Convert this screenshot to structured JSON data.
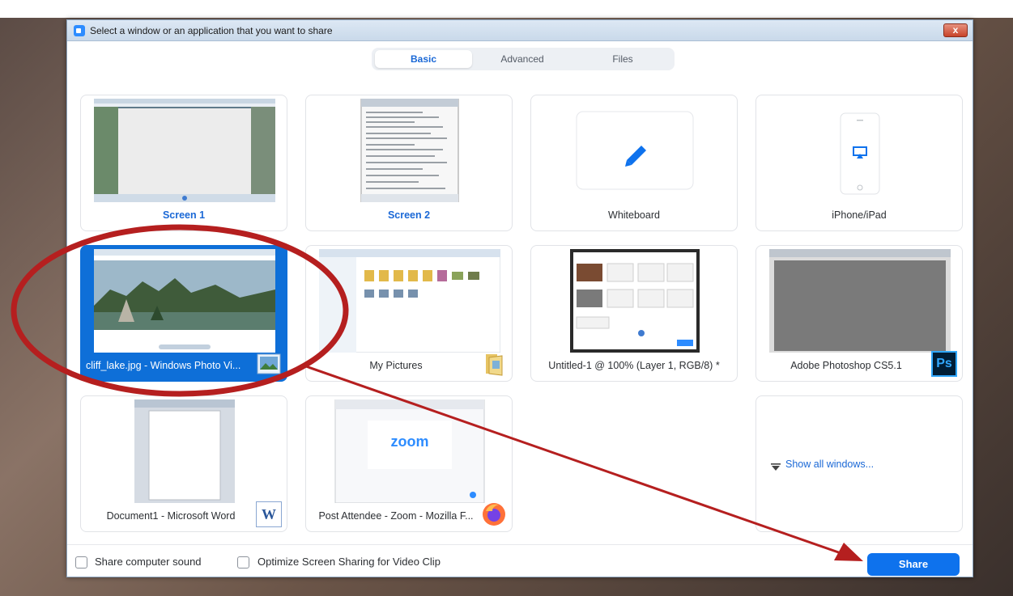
{
  "window": {
    "title": "Select a window or an application that you want to share",
    "close_glyph": "x"
  },
  "tabs": [
    {
      "label": "Basic",
      "active": true
    },
    {
      "label": "Advanced",
      "active": false
    },
    {
      "label": "Files",
      "active": false
    }
  ],
  "tiles": {
    "screen1": "Screen 1",
    "screen2": "Screen 2",
    "whiteboard": "Whiteboard",
    "iphone": "iPhone/iPad",
    "photo_viewer": "cliff_lake.jpg - Windows Photo Vi...",
    "my_pictures": "My Pictures",
    "untitled": "Untitled-1 @ 100% (Layer 1, RGB/8) *",
    "photoshop": "Adobe Photoshop CS5.1",
    "photoshop_badge": "Ps",
    "word": "Document1 - Microsoft Word",
    "word_badge": "W",
    "firefox": "Post Attendee - Zoom - Mozilla F...",
    "zoom_logo": "zoom",
    "show_all": "Show all windows..."
  },
  "footer": {
    "share_sound": "Share computer sound",
    "optimize": "Optimize Screen Sharing for Video Clip",
    "share_button": "Share"
  },
  "colors": {
    "accent": "#0e72ed",
    "selected_tile": "#0e6fd8",
    "annotation_red": "#b51f1f"
  },
  "selection": {
    "selected_tile": "cliff_lake.jpg - Windows Photo Vi..."
  }
}
